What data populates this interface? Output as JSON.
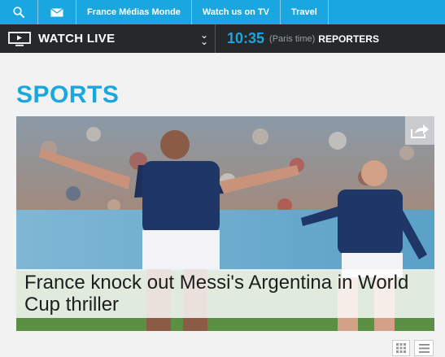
{
  "topnav": {
    "search_icon": "search-icon",
    "mail_icon": "mail-icon",
    "links": [
      "France Médias Monde",
      "Watch us on TV",
      "Travel"
    ]
  },
  "livebar": {
    "watch_label": "WATCH LIVE",
    "tv_icon": "tv-icon",
    "time": "10:35",
    "timezone": "(Paris time)",
    "reporters": "REPORTERS"
  },
  "section": {
    "title": "SPORTS"
  },
  "hero": {
    "headline": "France knock out Messi's Argentina in World Cup thriller",
    "share_icon": "share-icon"
  },
  "view_toggle": {
    "grid_icon": "grid-view-icon",
    "list_icon": "list-view-icon"
  },
  "colors": {
    "accent": "#1aa7df",
    "dark_bar": "#25292c",
    "background": "#f2f2f2"
  }
}
